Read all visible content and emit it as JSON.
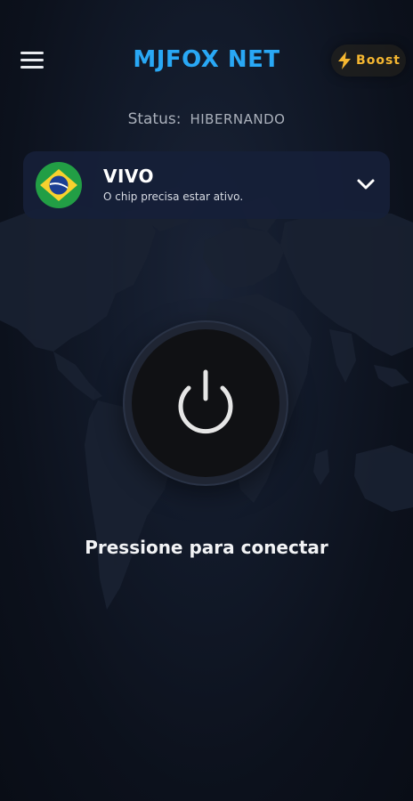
{
  "header": {
    "title": "MJFOX NET",
    "menu_icon": "hamburger-menu-icon",
    "boost": {
      "label": "Boost",
      "icon": "lightning-bolt-icon",
      "color": "#f5b731"
    }
  },
  "status": {
    "label": "Status:",
    "value": "HIBERNANDO"
  },
  "server": {
    "name": "VIVO",
    "subtitle": "O chip precisa estar ativo.",
    "flag_icon": "brazil-flag-icon",
    "dropdown_icon": "chevron-down-icon"
  },
  "connect": {
    "icon": "power-icon",
    "prompt": "Pressione para conectar"
  },
  "colors": {
    "accent": "#29a8f5",
    "background": "#0c111c",
    "card": "#162038"
  }
}
